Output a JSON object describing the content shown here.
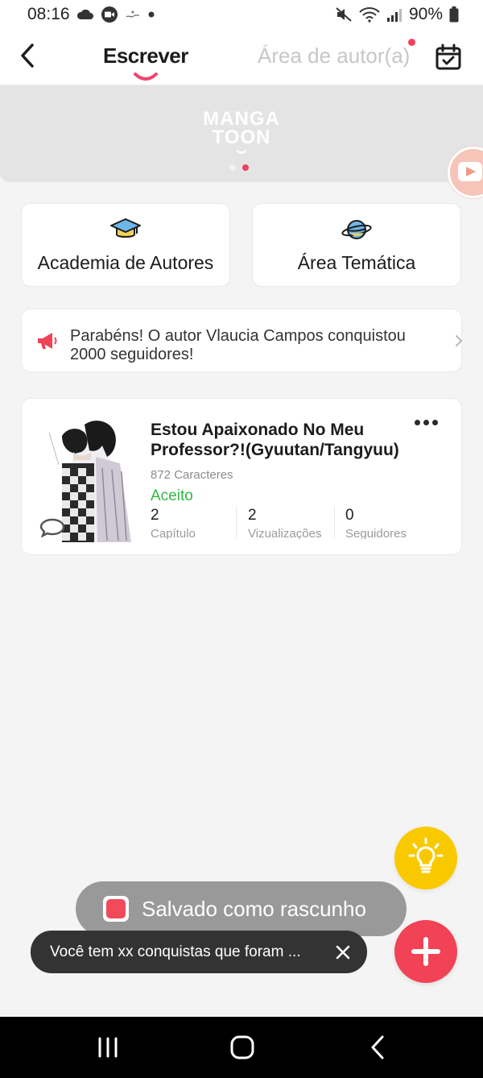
{
  "status_bar": {
    "time": "08:16",
    "battery": "90%"
  },
  "header": {
    "tab_write": "Escrever",
    "tab_author": "Área de autor(a)"
  },
  "banner": {
    "logo_line1": "MANGA",
    "logo_line2": "TOON"
  },
  "features": {
    "academy_label": "Academia de Autores",
    "themes_label": "Área Temática"
  },
  "notice": {
    "text": "Parabéns! O autor Vlaucia Campos conquistou 2000 seguidores!"
  },
  "work": {
    "title": "Estou Apaixonado No Meu Professor?!(Gyuutan/Tangyuu)",
    "char_count": "872 Caracteres",
    "status": "Aceito",
    "stats": [
      {
        "value": "2",
        "label": "Capítulo"
      },
      {
        "value": "2",
        "label": "Vizualizações"
      },
      {
        "value": "0",
        "label": "Seguidores"
      }
    ]
  },
  "toasts": {
    "saved": "Salvado como rascunho",
    "achievements": "Você tem xx conquistas que foram ..."
  },
  "colors": {
    "accent": "#f14256",
    "success": "#31b746",
    "idea": "#f9c900"
  }
}
